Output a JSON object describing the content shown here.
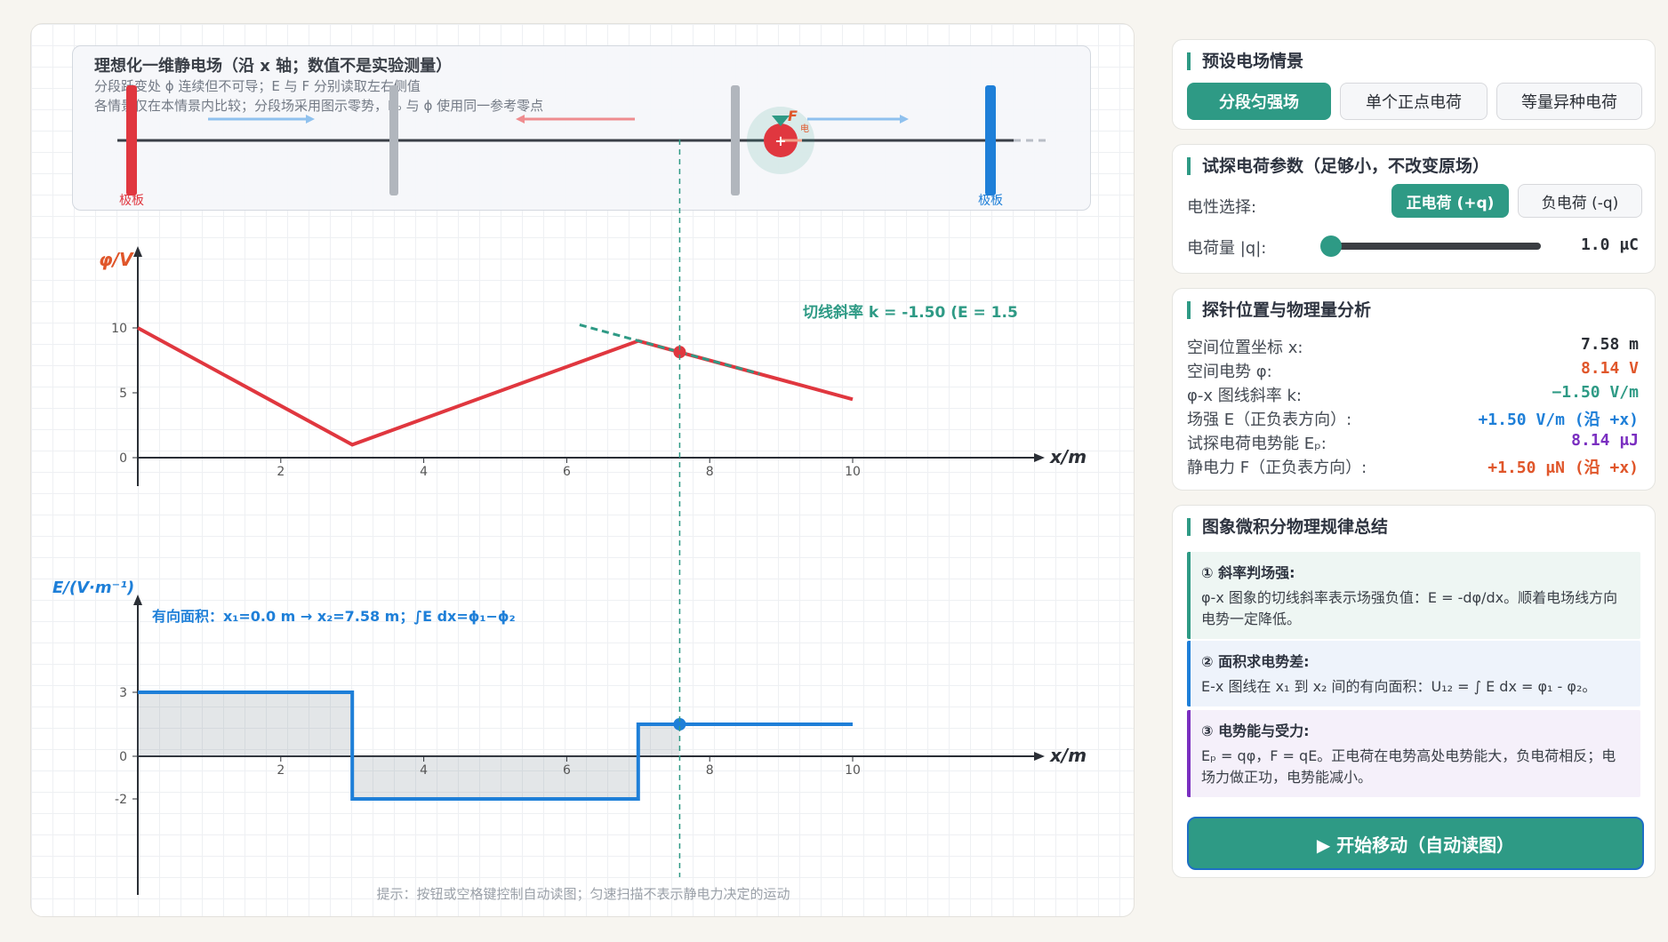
{
  "scene": {
    "title": "理想化一维静电场（沿 x 轴；数值不是实验测量）",
    "note1": "分段跃变处 ϕ 连续但不可导；E 与 F 分别读取左右侧值",
    "note2": "各情景仅在本情景内比较；分段场采用图示零势，Eₚ 与 ϕ 使用同一参考零点",
    "plate_left": "极板",
    "plate_right": "极板",
    "force_label": "F",
    "force_sub": "电",
    "charge_sign": "+"
  },
  "phi_chart": {
    "ylabel": "φ/V",
    "xlabel": "x/m",
    "x_ticks": [
      "2",
      "4",
      "6",
      "8",
      "10"
    ],
    "y_ticks": [
      "10",
      "5",
      "0"
    ],
    "tangent_label": "切线斜率 k = -1.50 (E = 1.5"
  },
  "e_chart": {
    "ylabel": "E/(V·m⁻¹)",
    "xlabel": "x/m",
    "x_ticks": [
      "2",
      "4",
      "6",
      "8",
      "10"
    ],
    "y_ticks": [
      "3",
      "0",
      "-2"
    ],
    "area_label": "有向面积：x₁=0.0 m → x₂=7.58 m；∫E dx=ϕ₁−ϕ₂"
  },
  "hint": "提示：按钮或空格键控制自动读图；匀速扫描不表示静电力决定的运动",
  "chart_data": [
    {
      "type": "line",
      "ylabel": "φ/V",
      "xlabel": "x/m",
      "xlim": [
        0,
        10
      ],
      "ylim": [
        0,
        10
      ],
      "series": [
        {
          "x": [
            0,
            3,
            7,
            10
          ],
          "y": [
            10,
            1,
            9,
            4.5
          ]
        }
      ],
      "probe": {
        "x": 7.58,
        "y": 8.14
      },
      "tangent_slope": -1.5
    },
    {
      "type": "line",
      "ylabel": "E/(V·m⁻¹)",
      "xlabel": "x/m",
      "xlim": [
        0,
        10
      ],
      "ylim": [
        -2,
        3
      ],
      "series": [
        {
          "x": [
            0,
            3,
            3,
            7,
            7,
            10
          ],
          "y": [
            3,
            3,
            -2,
            -2,
            1.5,
            1.5
          ]
        }
      ],
      "probe": {
        "x": 7.58,
        "y": 1.5
      },
      "shaded_area_x": [
        0,
        7.58
      ]
    }
  ],
  "presets": {
    "title": "预设电场情景",
    "buttons": [
      "分段匀强场",
      "单个正点电荷",
      "等量异种电荷"
    ]
  },
  "charge": {
    "title": "试探电荷参数（足够小，不改变原场）",
    "polarity_label": "电性选择:",
    "positive": "正电荷 (+q)",
    "negative": "负电荷 (-q)",
    "amount_label": "电荷量 |q|:",
    "amount_value": "1.0 μC",
    "amount_fraction": 0.0
  },
  "analysis": {
    "title": "探针位置与物理量分析",
    "rows": [
      {
        "label": "空间位置坐标 x:",
        "value": "7.58 m",
        "color": "#2b2f36"
      },
      {
        "label": "空间电势 φ:",
        "value": "8.14 V",
        "color": "#e0562a"
      },
      {
        "label": "φ-x 图线斜率 k:",
        "value": "−1.50 V/m",
        "color": "#2e9a85"
      },
      {
        "label": "场强 E（正负表方向）:",
        "value": "+1.50 V/m (沿 +x)",
        "color": "#1e7fd8"
      },
      {
        "label": "试探电荷电势能 Eₚ:",
        "value": "8.14 μJ",
        "color": "#7a2fc0"
      },
      {
        "label": "静电力 F（正负表方向）:",
        "value": "+1.50 μN (沿 +x)",
        "color": "#e0562a"
      }
    ]
  },
  "laws": {
    "title": "图象微积分物理规律总结",
    "items": [
      {
        "title": "① 斜率判场强:",
        "text": "φ-x 图象的切线斜率表示场强负值：E = -dφ/dx。顺着电场线方向电势一定降低。"
      },
      {
        "title": "② 面积求电势差:",
        "text": "E-x 图线在 x₁ 到 x₂ 间的有向面积：U₁₂ = ∫ E dx = φ₁ - φ₂。"
      },
      {
        "title": "③ 电势能与受力:",
        "text": "Eₚ = qφ，F = qE。正电荷在电势高处电势能大，负电荷相反；电场力做正功，电势能减小。"
      }
    ]
  },
  "start_button": "▶ 开始移动（自动读图）",
  "colors": {
    "accent": "#2e9a85",
    "phi": "#e0373f",
    "field": "#1e7fd8"
  }
}
